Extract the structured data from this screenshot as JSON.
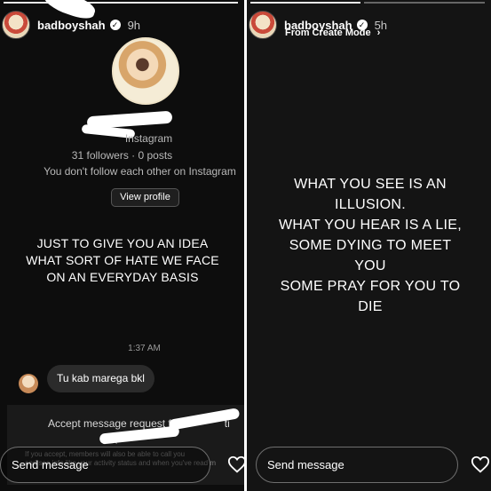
{
  "left_story": {
    "username": "badboyshah",
    "time": "9h",
    "dm": {
      "source": "Instagram",
      "stats": "31 followers · 0 posts",
      "follow_status": "You don't follow each other on Instagram",
      "view_profile_label": "View profile",
      "timestamp": "1:37 AM",
      "message": "Tu kab marega bkl",
      "accept_prefix": "Accept message request fr",
      "accept_suffix": "ti",
      "accept_line2": "(h",
      "accept_note_line1": "If you accept, members will also be able to call you",
      "accept_note_line2": "and see info like your activity status and when you've read m"
    },
    "caption": "JUST TO GIVE YOU AN IDEA WHAT SORT OF HATE WE FACE ON AN EVERYDAY BASIS",
    "send_placeholder": "Send message"
  },
  "right_story": {
    "username": "badboyshah",
    "time": "5h",
    "subline": "From Create Mode",
    "caption_lines": [
      "WHAT YOU SEE IS AN",
      "ILLUSION.",
      "WHAT YOU HEAR IS A LIE,",
      "SOME DYING TO MEET",
      "YOU",
      "SOME PRAY FOR YOU TO",
      "DIE"
    ],
    "send_placeholder": "Send message"
  },
  "icons": {
    "verified": "verified-badge-icon",
    "chevron": "chevron-right-icon",
    "heart": "heart-icon"
  }
}
